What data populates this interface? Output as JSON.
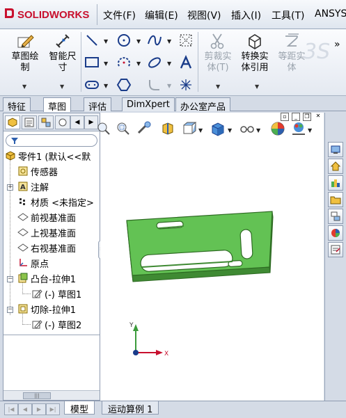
{
  "app": {
    "brand": "SOLIDWORKS",
    "brand_prefix": "3S"
  },
  "menu": {
    "items": [
      "文件(F)",
      "编辑(E)",
      "视图(V)",
      "插入(I)",
      "工具(T)",
      "ANSYS"
    ]
  },
  "command_manager": {
    "sketch_label_1": "草图绘",
    "sketch_label_2": "制",
    "smart_dim_label_1": "智能尺",
    "smart_dim_label_2": "寸",
    "trim_label_1": "剪裁实",
    "trim_label_2": "体(T)",
    "convert_label_1": "转换实",
    "convert_label_2": "体引用",
    "offset_label_1": "等距实",
    "offset_label_2": "体",
    "more": "»"
  },
  "tabs": [
    "特征",
    "草图",
    "评估",
    "DimXpert",
    "办公室产品"
  ],
  "active_tab_index": 1,
  "feature_tree": {
    "root": "零件1 (默认<<默",
    "items": [
      {
        "label": "传感器",
        "icon": "sensor-icon"
      },
      {
        "label": "注解",
        "icon": "annotation-icon"
      },
      {
        "label": "材质 <未指定>",
        "icon": "material-icon"
      },
      {
        "label": "前视基准面",
        "icon": "plane-icon"
      },
      {
        "label": "上视基准面",
        "icon": "plane-icon"
      },
      {
        "label": "右视基准面",
        "icon": "plane-icon"
      },
      {
        "label": "原点",
        "icon": "origin-icon"
      },
      {
        "label": "凸台-拉伸1",
        "icon": "boss-extrude-icon"
      },
      {
        "label": "(-) 草图1",
        "icon": "sketch-icon"
      },
      {
        "label": "切除-拉伸1",
        "icon": "cut-extrude-icon"
      },
      {
        "label": "(-) 草图2",
        "icon": "sketch-icon"
      }
    ]
  },
  "triad": {
    "x": "X",
    "y": "Y"
  },
  "bottom_tabs": [
    "模型",
    "运动算例 1"
  ],
  "colors": {
    "part_face": "#63c254",
    "part_edge": "#2d6a22",
    "part_side": "#4a9a3c",
    "brand_red": "#c8102e"
  }
}
